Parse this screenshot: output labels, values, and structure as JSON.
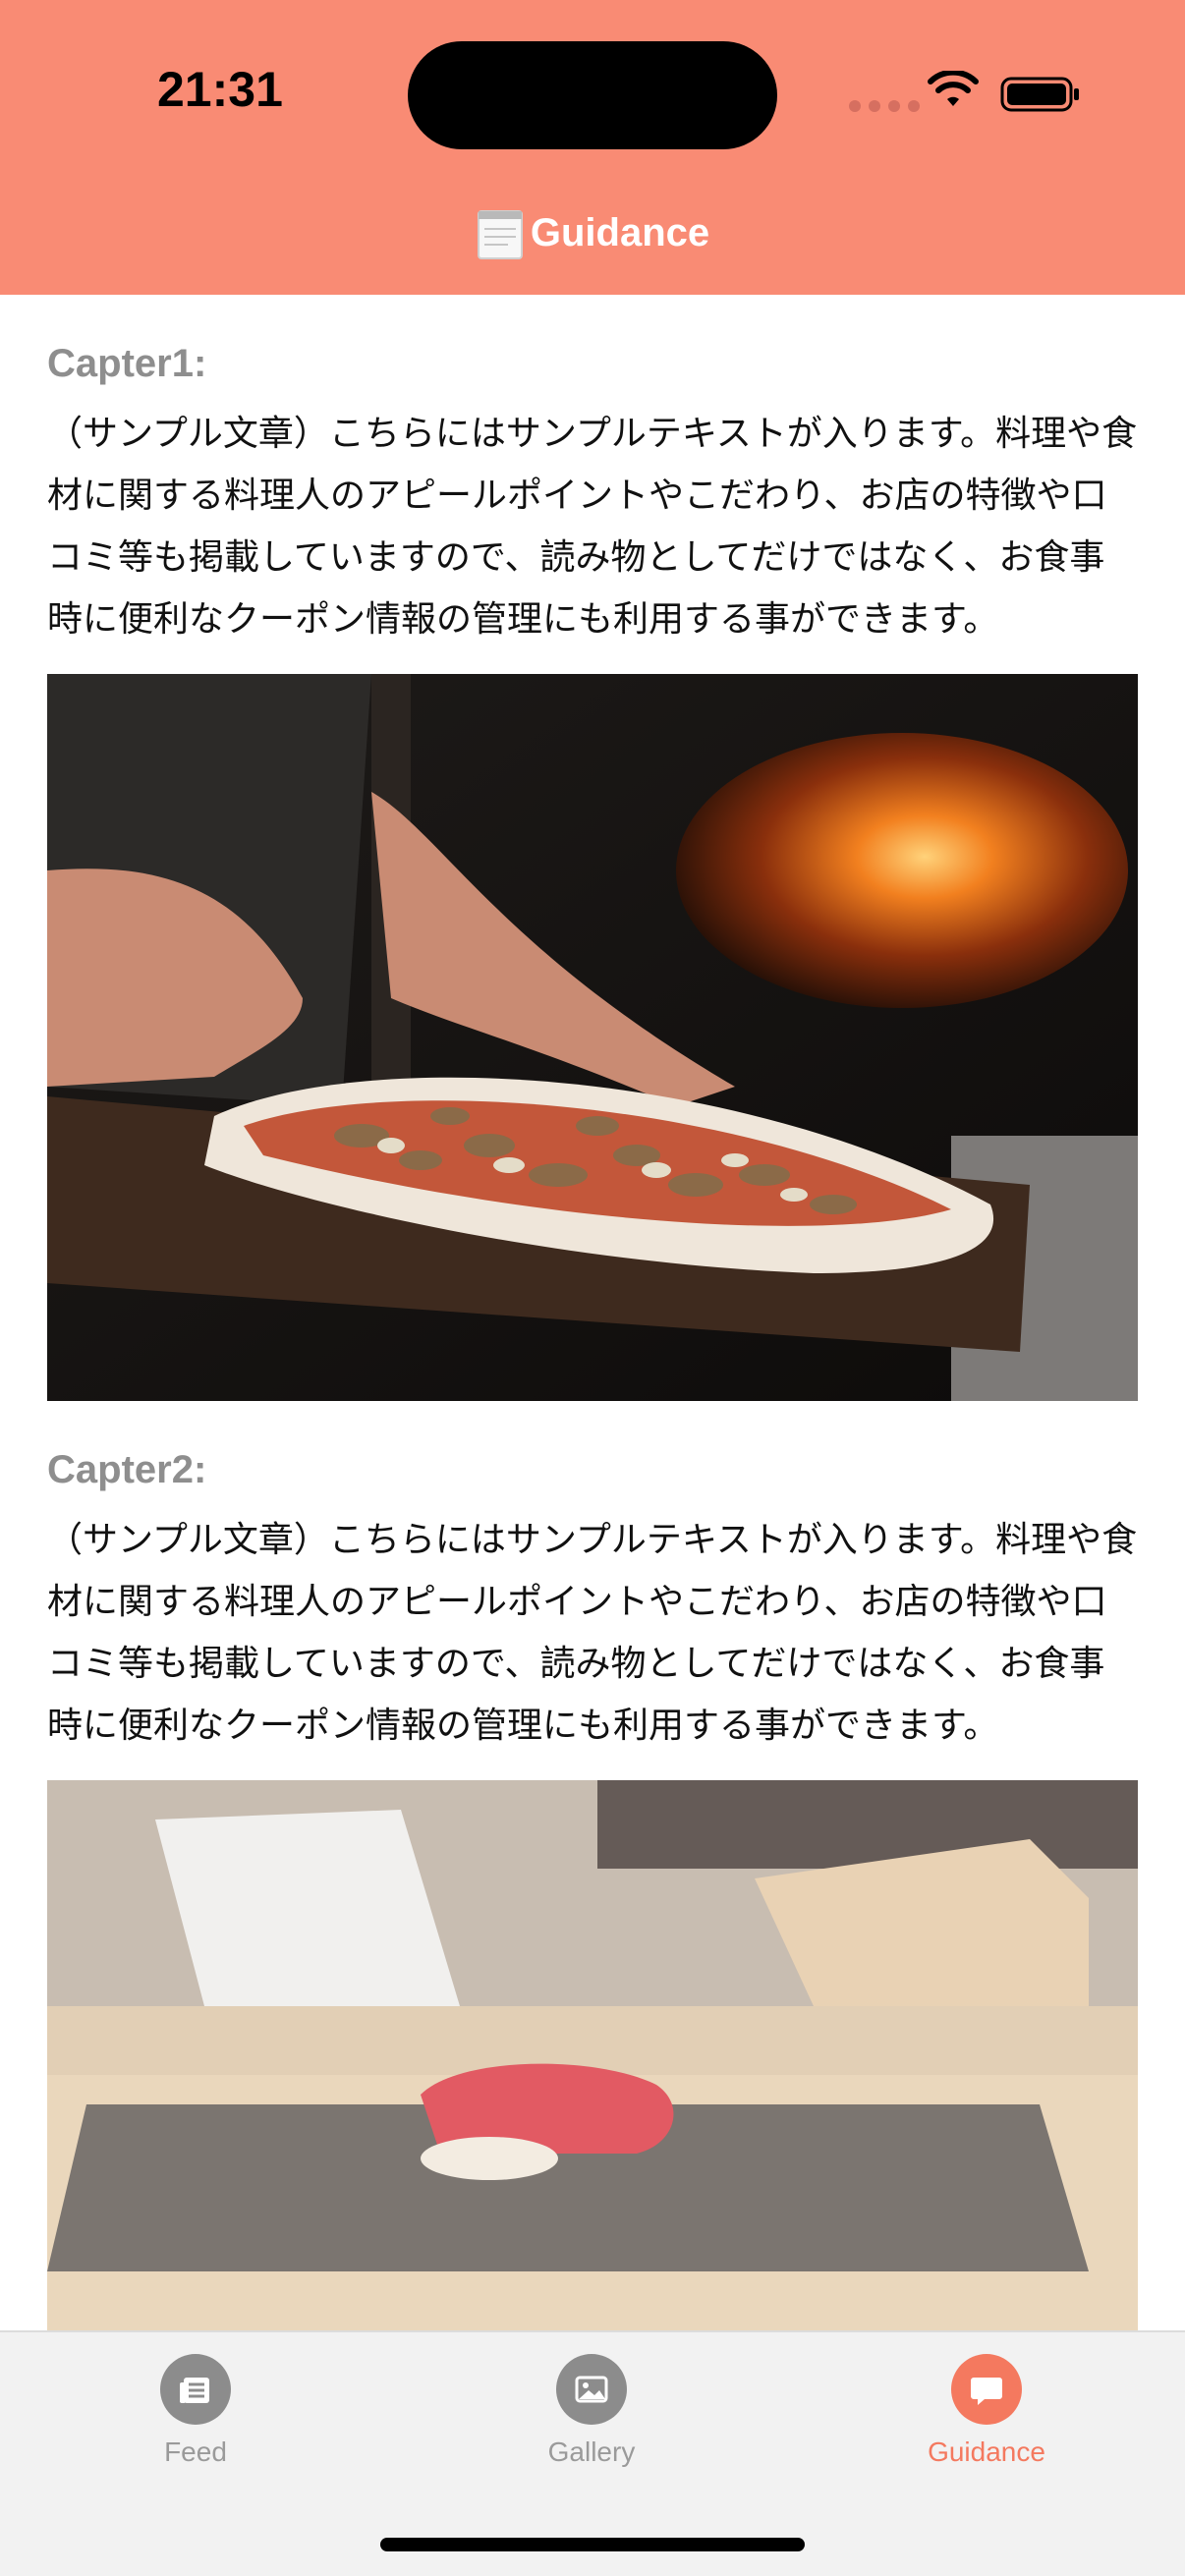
{
  "status_bar": {
    "time": "21:31"
  },
  "nav": {
    "title": "Guidance",
    "title_icon": "notepad-icon"
  },
  "chapters": [
    {
      "title": "Capter1:",
      "body": "（サンプル文章）こちらにはサンプルテキストが入ります。料理や食材に関する料理人のアピールポイントやこだわり、お店の特徴や口コミ等も掲載していますので、読み物としてだけではなく、お食事時に便利なクーポン情報の管理にも利用する事ができます。",
      "image": "pizza-photo"
    },
    {
      "title": "Capter2:",
      "body": "（サンプル文章）こちらにはサンプルテキストが入ります。料理や食材に関する料理人のアピールポイントやこだわり、お店の特徴や口コミ等も掲載していますので、読み物としてだけではなく、お食事時に便利なクーポン情報の管理にも利用する事ができます。",
      "image": "sushi-photo"
    }
  ],
  "tabbar": {
    "tabs": [
      {
        "label": "Feed",
        "icon": "feed-icon"
      },
      {
        "label": "Gallery",
        "icon": "gallery-icon"
      },
      {
        "label": "Guidance",
        "icon": "chat-bubble-icon"
      }
    ],
    "active": "Guidance"
  },
  "colors": {
    "header": "#f98b74",
    "accent": "#f4795f",
    "inactive": "#8c8c8c"
  }
}
